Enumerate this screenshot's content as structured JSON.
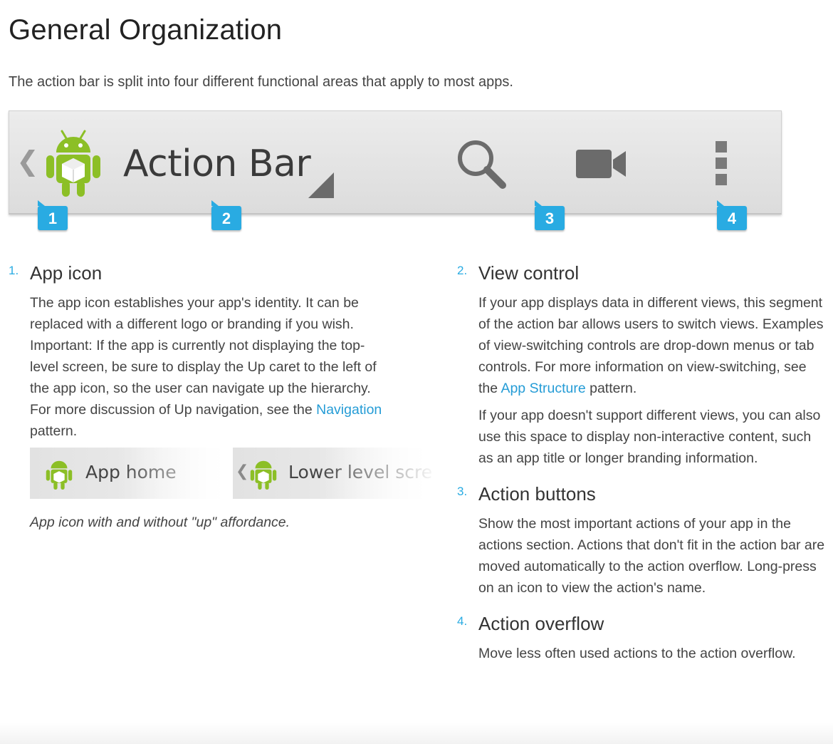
{
  "page": {
    "title": "General Organization",
    "intro": "The action bar is split into four different functional areas that apply to most apps."
  },
  "action_bar": {
    "up_caret": "❮",
    "title": "Action Bar",
    "icons": [
      "android-app-icon",
      "dropdown-triangle-icon",
      "search-icon",
      "video-camera-icon",
      "overflow-menu-icon"
    ],
    "markers": [
      "1",
      "2",
      "3",
      "4"
    ],
    "colors": {
      "marker": "#29abe2",
      "bar": "#e4e4e4",
      "icon": "#6b6b6b",
      "android_green": "#8cbf26"
    }
  },
  "items": [
    {
      "number": "1.",
      "title": "App icon",
      "body": "The app icon establishes your app's identity. It can be replaced with a different logo or branding if you wish. Important: If the app is currently not displaying the top-level screen, be sure to display the Up caret to the left of the app icon, so the user can navigate up the hierarchy. For more discussion of Up navigation, see the ",
      "link": "Navigation",
      "body_after": " pattern.",
      "thumbs": [
        {
          "label": "App home"
        },
        {
          "label": "Lower level screen",
          "caret": "❮"
        }
      ],
      "caption": "App icon with and without \"up\" affordance."
    },
    {
      "number": "2.",
      "title": "View control",
      "body": "If your app displays data in different views, this segment of the action bar allows users to switch views. Examples of view-switching controls are drop-down menus or tab controls. For more information on view-switching, see the ",
      "link": "App Structure",
      "body_after": " pattern.",
      "body2": "If your app doesn't support different views, you can also use this space to display non-interactive content, such as an app title or longer branding information."
    },
    {
      "number": "3.",
      "title": "Action buttons",
      "body": "Show the most important actions of your app in the actions section. Actions that don't fit in the action bar are moved automatically to the action overflow. Long-press on an icon to view the action's name."
    },
    {
      "number": "4.",
      "title": "Action overflow",
      "body": "Move less often used actions to the action overflow."
    }
  ]
}
